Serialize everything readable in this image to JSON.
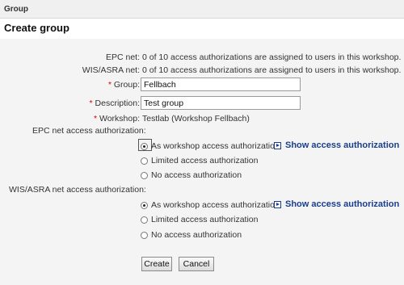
{
  "top_bar": {
    "title": "Group"
  },
  "heading": "Create group",
  "info": {
    "epc_label": "EPC net:",
    "epc_value": "0 of 10 access authorizations are assigned to users in this workshop.",
    "wis_label": "WIS/ASRA net:",
    "wis_value": "0 of 10 access authorizations are assigned to users in this workshop."
  },
  "form": {
    "required_mark": "*",
    "group_label": "Group:",
    "group_value": "Fellbach",
    "description_label": "Description:",
    "description_value": "Test group",
    "workshop_label": "Workshop:",
    "workshop_value": "Testlab (Workshop Fellbach)"
  },
  "epc_section": {
    "title": "EPC net access authorization:",
    "options": [
      {
        "label": "As workshop access authorization",
        "selected": true
      },
      {
        "label": "Limited access authorization",
        "selected": false
      },
      {
        "label": "No access authorization",
        "selected": false
      }
    ],
    "show_link": "Show access authorization"
  },
  "wis_section": {
    "title": "WIS/ASRA net access authorization:",
    "options": [
      {
        "label": "As workshop access authorization",
        "selected": true
      },
      {
        "label": "Limited access authorization",
        "selected": false
      },
      {
        "label": "No access authorization",
        "selected": false
      }
    ],
    "show_link": "Show access authorization"
  },
  "buttons": {
    "create": "Create",
    "cancel": "Cancel"
  },
  "icons": {
    "link_arrow": "play-arrow-icon"
  },
  "colors": {
    "link": "#1a3e8c",
    "required": "#dd0000",
    "panel": "#f4f4f4"
  }
}
